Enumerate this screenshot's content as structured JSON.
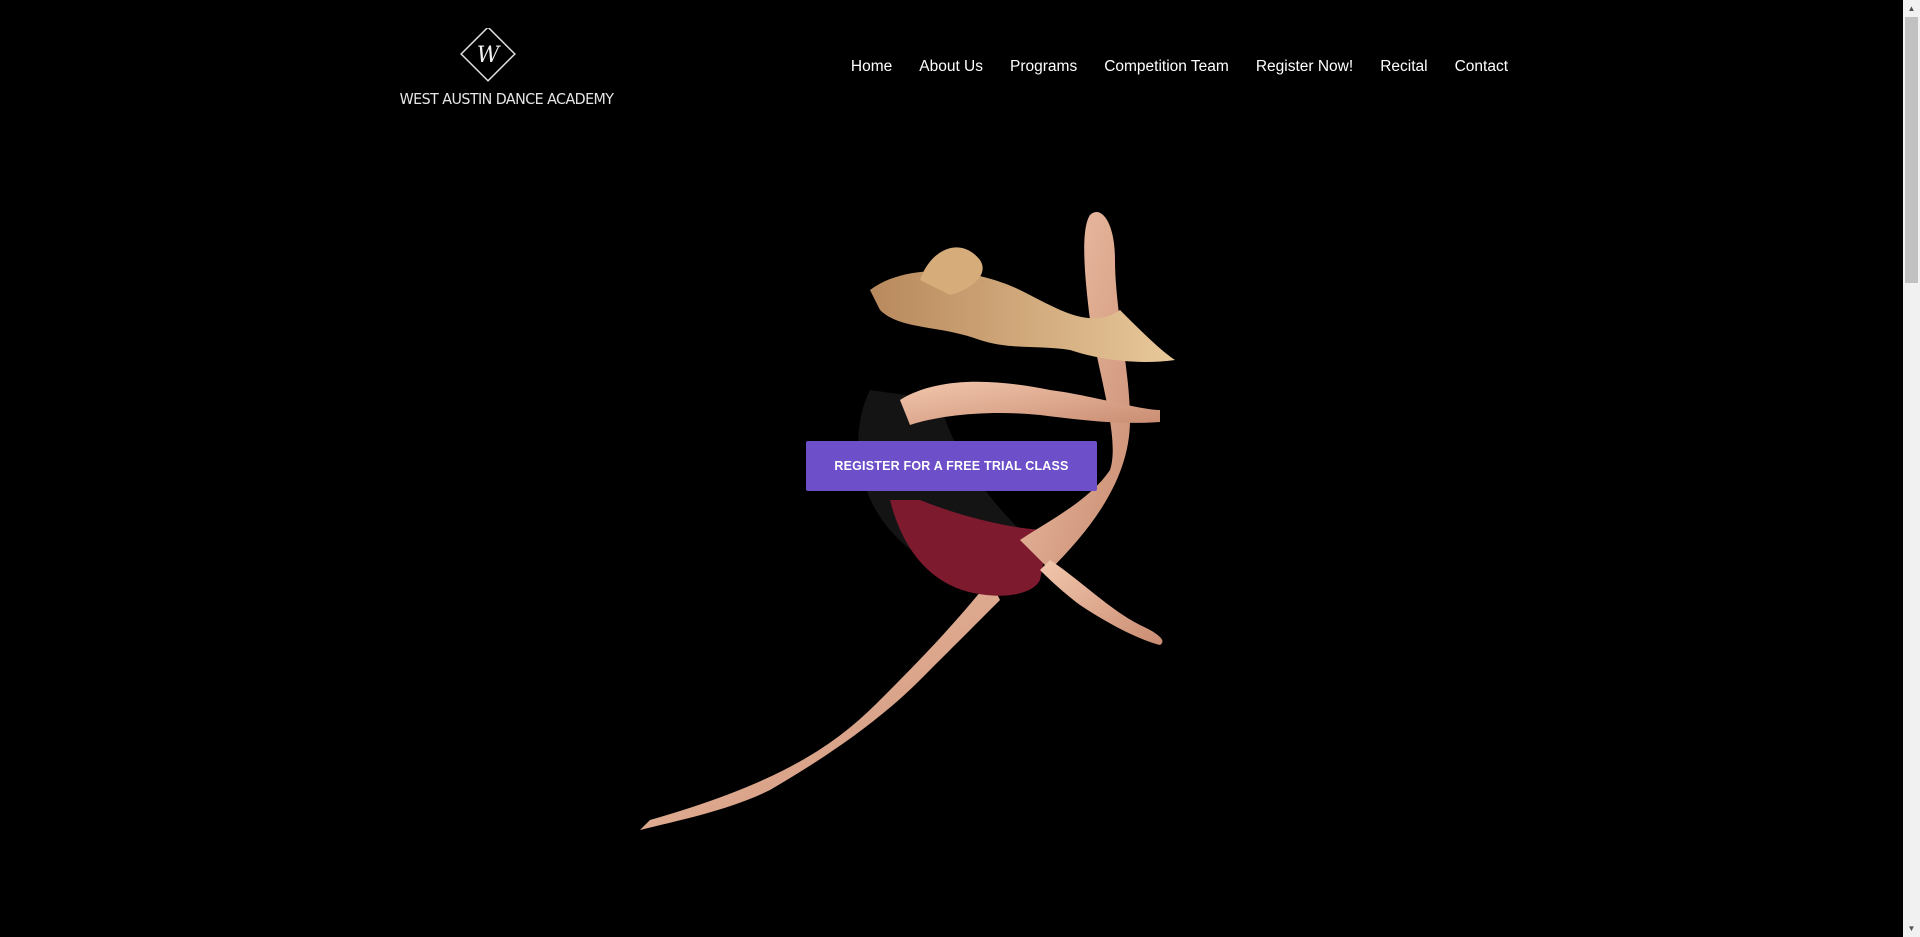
{
  "logo": {
    "monogram": "W",
    "text": "WEST AUSTIN DANCE ACADEMY"
  },
  "nav": {
    "items": [
      {
        "label": "Home"
      },
      {
        "label": "About Us"
      },
      {
        "label": "Programs"
      },
      {
        "label": "Competition Team"
      },
      {
        "label": "Register Now!"
      },
      {
        "label": "Recital"
      },
      {
        "label": "Contact"
      }
    ]
  },
  "hero": {
    "cta_label": "REGISTER FOR A FREE TRIAL CLASS",
    "cta_color": "#6c4fc9",
    "image": "dancer-leaping-photo"
  },
  "scrollbar": {
    "up_icon": "chevron-up-icon",
    "down_icon": "chevron-down-icon"
  }
}
